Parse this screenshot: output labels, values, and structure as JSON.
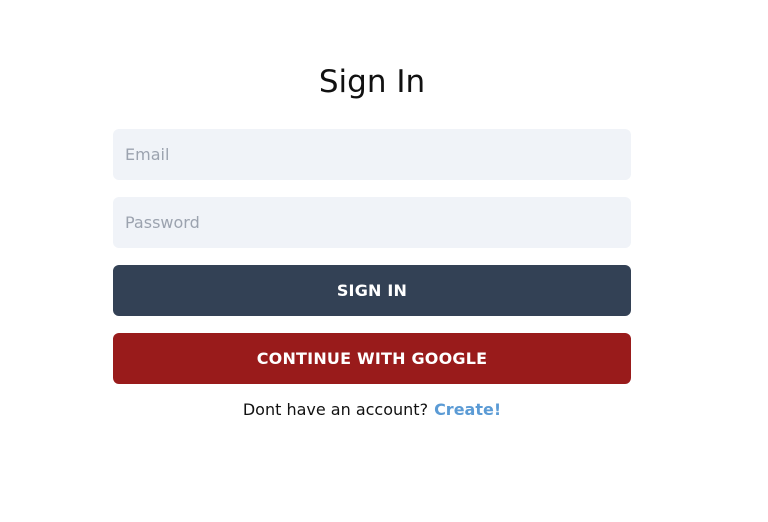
{
  "form": {
    "title": "Sign In",
    "email": {
      "placeholder": "Email",
      "value": ""
    },
    "password": {
      "placeholder": "Password",
      "value": ""
    },
    "signin_label": "SIGN IN",
    "google_label": "CONTINUE WITH GOOGLE",
    "footer_text": "Dont have an account?",
    "create_link": "Create!"
  },
  "colors": {
    "input_bg": "#f0f3f8",
    "signin_button": "#334155",
    "google_button": "#991b1b",
    "link": "#5b9bd5"
  }
}
